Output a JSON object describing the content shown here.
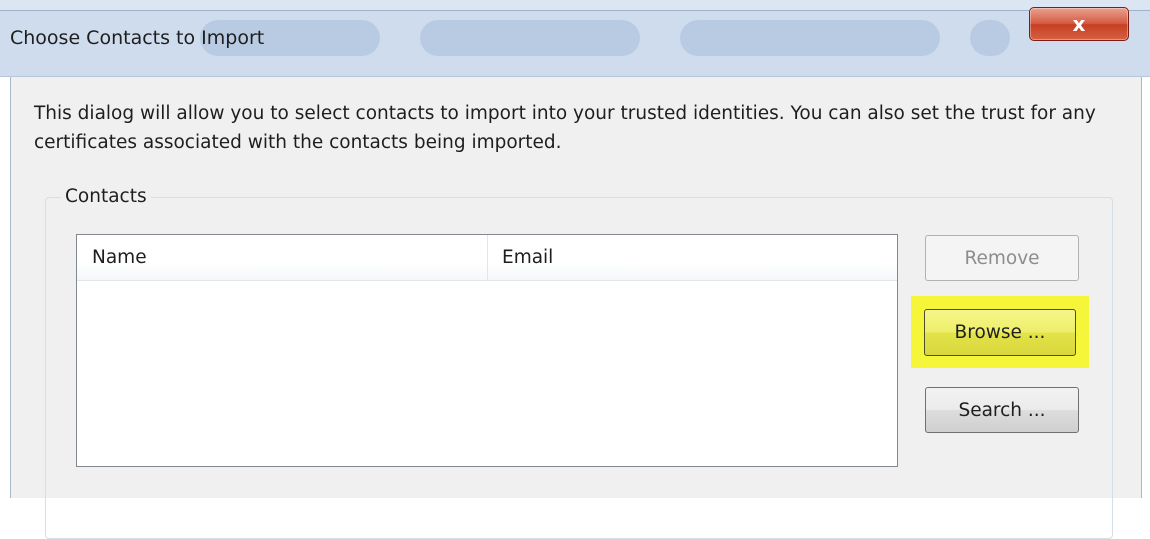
{
  "window": {
    "title": "Choose Contacts to Import",
    "close_glyph": "x"
  },
  "dialog": {
    "description": "This dialog will allow you to select contacts to import into your trusted identities. You can also set the trust for any certificates associated with the contacts being imported."
  },
  "contacts": {
    "group_label": "Contacts",
    "columns": [
      "Name",
      "Email"
    ],
    "rows": []
  },
  "buttons": {
    "remove": "Remove",
    "browse": "Browse ...",
    "search": "Search ..."
  },
  "colors": {
    "highlight": "#f5f53a",
    "close_button": "#c73f23",
    "dialog_background": "#f0f0f0"
  },
  "icons": {
    "close": "close-icon"
  }
}
